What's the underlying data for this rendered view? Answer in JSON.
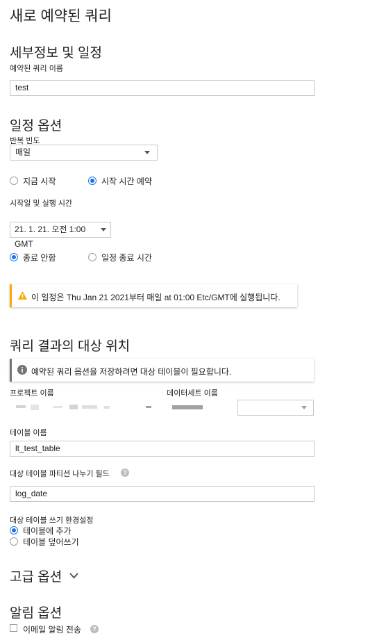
{
  "page": {
    "title": "새로 예약된 쿼리"
  },
  "details": {
    "heading": "세부정보 및 일정",
    "query_name_label": "예약된 쿼리 이름",
    "query_name_value": "test"
  },
  "schedule": {
    "heading": "일정 옵션",
    "repeat_label": "반복 빈도",
    "repeat_value": "매일",
    "start_now_label": "지금 시작",
    "schedule_start_label": "시작 시간 예약",
    "start_time_label": "시작일 및 실행 시간",
    "start_time_value": "21. 1. 21. 오전 1:00 GMT",
    "end_never_label": "종료 안함",
    "end_time_label": "일정 종료 시간",
    "notice_text": "이 일정은 Thu Jan 21 2021부터 매일 at 01:00 Etc/GMT에 실행됩니다.",
    "notice_color": "#f9ab00"
  },
  "destination": {
    "heading": "쿼리 결과의 대상 위치",
    "info_text": "예약된 쿼리 옵션을 저장하려면 대상 테이블이 필요합니다.",
    "project_label": "프로젝트 이름",
    "dataset_label": "데이터세트 이름",
    "table_label": "테이블 이름",
    "table_value": "lt_test_table",
    "partition_label": "대상 테이블 파티션 나누기 필드",
    "partition_value": "log_date",
    "write_pref_label": "대상 테이블 쓰기 환경설정",
    "append_label": "테이블에 추가",
    "overwrite_label": "테이블 덮어쓰기"
  },
  "advanced": {
    "heading": "고급 옵션"
  },
  "notifications": {
    "heading": "알림 옵션",
    "email_label": "이메일 알림 전송"
  },
  "colors": {
    "accent": "#1a73e8",
    "info_bar": "#757575"
  }
}
